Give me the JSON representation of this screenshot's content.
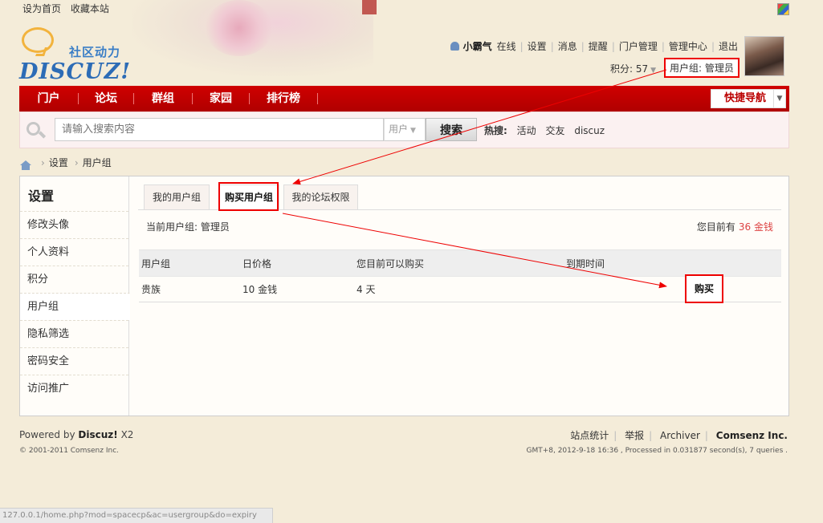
{
  "top_links": [
    "设为首页",
    "收藏本站"
  ],
  "logo": {
    "slogan": "社区动力",
    "brand": "DISCUZ!"
  },
  "user_bar": {
    "username": "小霸气",
    "links": [
      "在线",
      "设置",
      "消息",
      "提醒",
      "门户管理",
      "管理中心",
      "退出"
    ],
    "points_label": "积分: 57",
    "usergroup_label": "用户组: 管理员"
  },
  "nav": {
    "items": [
      "门户",
      "论坛",
      "群组",
      "家园",
      "排行榜"
    ],
    "quick_nav": "快捷导航"
  },
  "search": {
    "placeholder": "请输入搜索内容",
    "type": "用户",
    "button": "搜索",
    "hot_label": "热搜:",
    "hot_terms": [
      "活动",
      "交友",
      "discuz"
    ]
  },
  "breadcrumb": [
    "设置",
    "用户组"
  ],
  "sidebar": {
    "title": "设置",
    "items": [
      "修改头像",
      "个人资料",
      "积分",
      "用户组",
      "隐私筛选",
      "密码安全",
      "访问推广"
    ],
    "active_index": 3
  },
  "tabs": [
    "我的用户组",
    "购买用户组",
    "我的论坛权限"
  ],
  "active_tab": 1,
  "current_group": "当前用户组: 管理员",
  "balance": {
    "label": "您目前有",
    "amount": "36 金钱"
  },
  "table": {
    "headers": [
      "用户组",
      "日价格",
      "您目前可以购买",
      "到期时间"
    ],
    "rows": [
      {
        "group": "贵族",
        "price": "10 金钱",
        "can_buy": "4 天",
        "expiry": "",
        "action": "购买"
      }
    ]
  },
  "footer": {
    "powered_prefix": "Powered by",
    "powered_brand": "Discuz!",
    "powered_version": "X2",
    "copyright": "© 2001-2011 Comsenz Inc.",
    "links": [
      "站点统计",
      "举报",
      "Archiver"
    ],
    "company": "Comsenz Inc.",
    "gmt": "GMT+8, 2012-9-18 16:36 , Processed in 0.031877 second(s), 7 queries ."
  },
  "status_url": "127.0.0.1/home.php?mod=spacecp&ac=usergroup&do=expiry",
  "colors": {
    "nav_red": "#c00000",
    "highlight_red": "#ee0000",
    "accent_amount": "#dd4444"
  }
}
